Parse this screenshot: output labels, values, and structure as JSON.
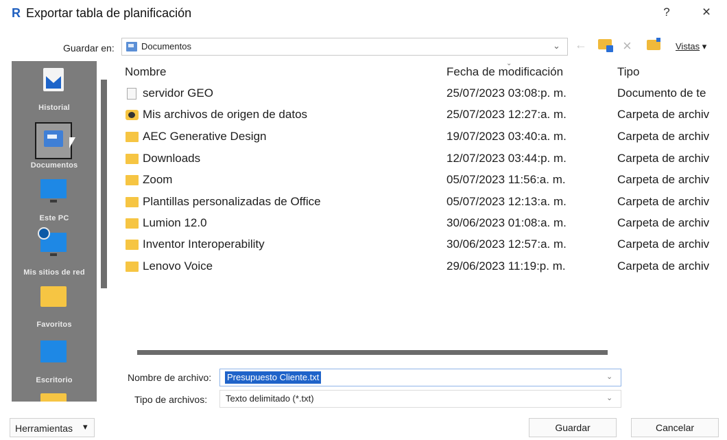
{
  "window": {
    "logo": "R",
    "title": "Exportar tabla de planificación",
    "help_label": "?",
    "close_label": "×"
  },
  "toolbar": {
    "save_in_label": "Guardar en:",
    "location": "Documentos",
    "views_label": "Vistas",
    "back_icon": "←",
    "delete_icon": "×",
    "dropdown_icon": "⌄"
  },
  "places": [
    {
      "name": "place-recent",
      "label": "Historial"
    },
    {
      "name": "place-documents",
      "label": "Documentos"
    },
    {
      "name": "place-this-pc",
      "label": "Este PC"
    },
    {
      "name": "place-network",
      "label": "Mis sitios de red"
    },
    {
      "name": "place-favorites",
      "label": "Favoritos"
    },
    {
      "name": "place-desktop",
      "label": "Escritorio"
    }
  ],
  "file_list": {
    "columns": [
      "Nombre",
      "Fecha de modificación",
      "Tipo"
    ],
    "rows": [
      {
        "icon": "file-icon",
        "name": "servidor GEO",
        "date": "25/07/2023 03:08:p. m.",
        "type": "Documento de te"
      },
      {
        "icon": "special-folder-icon",
        "name": "Mis archivos de origen de datos",
        "date": "25/07/2023 12:27:a. m.",
        "type": "Carpeta de archiv"
      },
      {
        "icon": "folder-icon",
        "name": "AEC Generative Design",
        "date": "19/07/2023 03:40:a. m.",
        "type": "Carpeta de archiv"
      },
      {
        "icon": "folder-icon",
        "name": "Downloads",
        "date": "12/07/2023 03:44:p. m.",
        "type": "Carpeta de archiv"
      },
      {
        "icon": "folder-icon",
        "name": "Zoom",
        "date": "05/07/2023 11:56:a. m.",
        "type": "Carpeta de archiv"
      },
      {
        "icon": "folder-icon",
        "name": "Plantillas personalizadas de Office",
        "date": "05/07/2023 12:13:a. m.",
        "type": "Carpeta de archiv"
      },
      {
        "icon": "folder-icon",
        "name": "Lumion 12.0",
        "date": "30/06/2023 01:08:a. m.",
        "type": "Carpeta de archiv"
      },
      {
        "icon": "folder-icon",
        "name": "Inventor Interoperability",
        "date": "30/06/2023 12:57:a. m.",
        "type": "Carpeta de archiv"
      },
      {
        "icon": "folder-icon",
        "name": "Lenovo Voice",
        "date": "29/06/2023 11:19:p. m.",
        "type": "Carpeta de archiv"
      }
    ]
  },
  "form": {
    "filename_label": "Nombre de archivo:",
    "filename_value": "Presupuesto Cliente.txt",
    "filetype_label": "Tipo de archivos:",
    "filetype_value": "Texto delimitado (*.txt)"
  },
  "buttons": {
    "tools_label": "Herramientas",
    "tools_arrow": "▾",
    "save_label": "Guardar",
    "cancel_label": "Cancelar"
  }
}
